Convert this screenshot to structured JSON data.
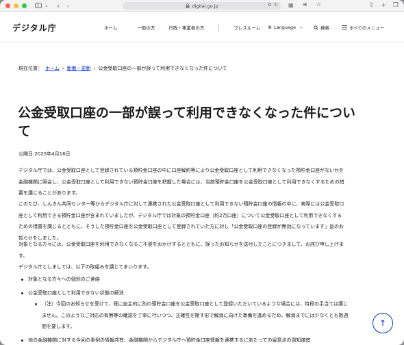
{
  "browser": {
    "url": "digital.go.jp",
    "icons": [
      "sidebar-icon",
      "chevron-down-icon",
      "back-icon",
      "forward-icon",
      "lock-icon",
      "translate-icon",
      "reload-icon",
      "grid-icon",
      "download-icon",
      "star-icon",
      "share-icon",
      "new-tab-icon",
      "tabs-icon"
    ]
  },
  "header": {
    "logo": "デジタル庁",
    "nav": {
      "home": "ホーム",
      "general": "一般の方",
      "gov": "行政・事業者の方",
      "press": "プレスルーム",
      "language": "Language",
      "search": "検索",
      "menu": "すべてのメニュー"
    }
  },
  "breadcrumb": {
    "prefix": "現在位置：",
    "home": "ホーム",
    "news": "新着・更新",
    "current": "公金受取口座の一部が誤って利用できなくなった件について"
  },
  "article": {
    "title_line1": "公金受取口座の一部が誤って利用できなくなった件につい",
    "title_line2": "て",
    "published": "公開日:2025年4月16日",
    "p1_l1": "デジタル庁では、公金受取口座として登録されている預貯金口座の中に口座解約等により公金受取口座として利用できなくなった預貯金口座がないかを",
    "p1_l2": "金融機関に照会し、公金受取口座として利用できない預貯金口座を把握した場合には、当該預貯金口座を公金受取口座として利用できなくするための措",
    "p1_l3": "置を講じることがあります。",
    "p2_l1": "このたび、しんきん共同センター等からデジタル庁に対して連携された公金受取口座として利用できない預貯金口座の情報の中に、実際には公金受取口",
    "p2_l2": "座として利用できる預貯金口座が含まれていましたが、デジタル庁では対象の預貯金口座（約2万口座）について公金受取口座として利用できなくする",
    "p2_l3": "ための措置を講じるとともに、そうした預貯金口座を公金受取口座として登録されていた方に対し「公金受取口座の登録が無効になっています」旨のお",
    "p2_l4": "知らせをしました。",
    "p3_l1": "対象となる方々には、公金受取口座を利用できなくなるご不便をおかけするとともに、誤ったお知らせを送付したことにつきまして、お詫び申し上げま",
    "p3_l2": "す。",
    "p3_l3": "デジタル庁としましては、以下の取組みを講じてまいります。",
    "list": {
      "item1": "対象となる方々への個別のご連絡",
      "item2": "公金受取口座として利用できない状態の解消",
      "nested_l1": "（注）今回のお知らせを受けて、既に自主的に別の預貯金口座を公金受取口座として登録いただいているような場合には、特段の手当ては講じ",
      "nested_l2": "ません。このようなご対応の有無等の確認を丁寧に行いつつ、正確性を期す形で解消に向けた準備を進めるため、解消までには少なくとも数週",
      "nested_l3": "間を要します。",
      "item3": "他の金融機関に対する今回の事例の情報共有、金融機関からデジタル庁へ預貯金口座情報を連携するにあたっての留意点の周知徹底"
    }
  },
  "colors": {
    "link": "#0031d8",
    "text": "#1a1a1c"
  }
}
